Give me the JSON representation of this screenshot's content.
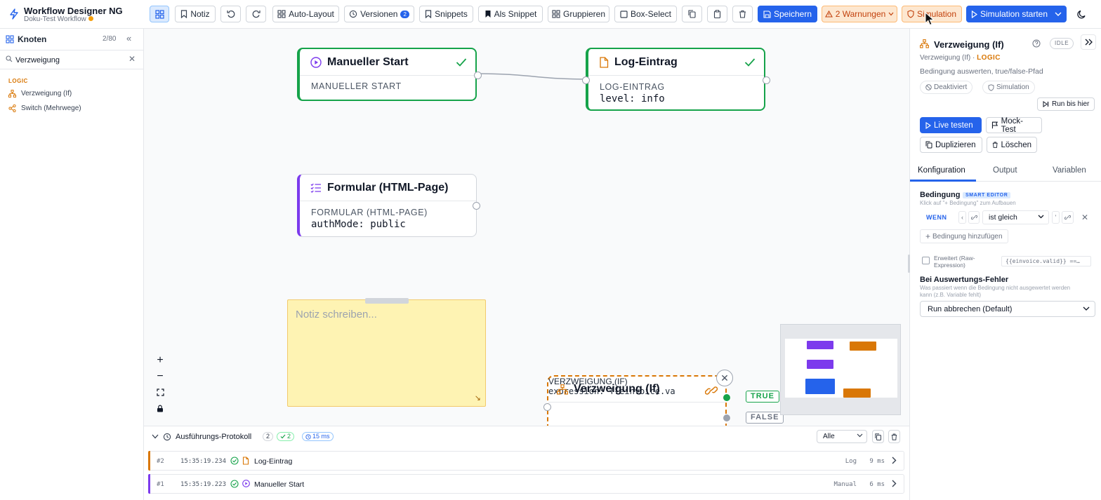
{
  "app": {
    "title": "Workflow Designer NG",
    "subtitle": "Doku-Test Workflow"
  },
  "toolbar": {
    "notiz": "Notiz",
    "auto_layout": "Auto-Layout",
    "versionen": "Versionen",
    "versionen_count": "2",
    "snippets": "Snippets",
    "als_snippet": "Als Snippet",
    "gruppieren": "Gruppieren",
    "box_select": "Box-Select",
    "speichern": "Speichern",
    "warnungen": "2 Warnungen",
    "simulation": "Simulation",
    "simulation_starten": "Simulation starten"
  },
  "sidebar": {
    "title": "Knoten",
    "count": "2/80",
    "search": {
      "value": "Verzweigung",
      "placeholder": ""
    },
    "category": "LOGIC",
    "items": [
      {
        "label": "Verzweigung (If)",
        "icon": "sitemap-icon"
      },
      {
        "label": "Switch (Mehrwege)",
        "icon": "share-icon"
      }
    ]
  },
  "canvas": {
    "nodes": [
      {
        "title": "Manueller Start",
        "type": "MANUELLER START",
        "value": "",
        "accent": "#7c3aed",
        "status": "success"
      },
      {
        "title": "Log-Eintrag",
        "type": "LOG-EINTRAG",
        "value": "level: info",
        "accent": "#d97706",
        "status": "success"
      },
      {
        "title": "Formular (HTML-Page)",
        "type": "FORMULAR (HTML-PAGE)",
        "value": "authMode: public",
        "accent": "#7c3aed",
        "status": ""
      },
      {
        "title": "Verzweigung (If)",
        "type": "VERZWEIGUNG (IF)",
        "value": "expression: {{einvoice.va",
        "accent": "#d97706",
        "status": "selected"
      }
    ],
    "note_placeholder": "Notiz schreiben...",
    "branch_true": "TRUE",
    "branch_false": "FALSE"
  },
  "log": {
    "title": "Ausführungs-Protokoll",
    "count": "2",
    "success_count": "2",
    "duration": "15 ms",
    "filter": "Alle",
    "rows": [
      {
        "num": "#2",
        "time": "15:35:19.234",
        "name": "Log-Eintrag",
        "kind": "Log",
        "dur": "9 ms",
        "accent": "#d97706"
      },
      {
        "num": "#1",
        "time": "15:35:19.223",
        "name": "Manueller Start",
        "kind": "Manual",
        "dur": "6 ms",
        "accent": "#7c3aed"
      }
    ]
  },
  "panel": {
    "title": "Verzweigung (If)",
    "state": "IDLE",
    "subtitle_name": "Verzweigung (If) ·",
    "subtitle_cat": "LOGIC",
    "description": "Bedingung auswerten, true/false-Pfad",
    "chip_deaktiviert": "Deaktiviert",
    "chip_simulation": "Simulation",
    "run_bis_hier": "Run bis hier",
    "live_testen": "Live testen",
    "mock_test": "Mock-Test",
    "duplizieren": "Duplizieren",
    "loeschen": "Löschen",
    "tabs": [
      "Konfiguration",
      "Output",
      "Variablen"
    ],
    "bedingung_label": "Bedingung",
    "smart_editor": "SMART EDITOR",
    "bedingung_hint": "Klick auf \"+ Bedingung\" zum Aufbauen",
    "wenn": "WENN",
    "operator": "ist gleich",
    "add_condition": "Bedingung hinzufügen",
    "advanced_label": "Erweitert (Raw-Expression)",
    "raw_expression": "{{einvoice.valid}} ==…",
    "error_title": "Bei Auswertungs-Fehler",
    "error_hint": "Was passiert wenn die Bedingung nicht ausgewertet werden kann (z.B. Variable fehlt)",
    "error_option": "Run abbrechen (Default)"
  },
  "colors": {
    "accent": "#2563eb",
    "logic": "#d97706",
    "trigger": "#7c3aed",
    "success": "#16a34a"
  }
}
